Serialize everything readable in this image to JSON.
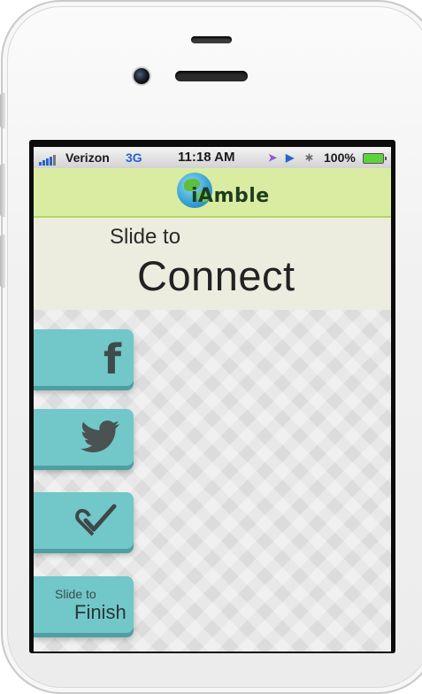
{
  "status_bar": {
    "carrier": "Verizon",
    "network": "3G",
    "time": "11:18 AM",
    "battery_percent": "100%"
  },
  "app": {
    "name": "iAmble"
  },
  "banner": {
    "line1": "Slide to",
    "line2": "Connect"
  },
  "tabs": [
    {
      "id": "facebook",
      "icon": "facebook-icon"
    },
    {
      "id": "twitter",
      "icon": "twitter-icon"
    },
    {
      "id": "foursquare",
      "icon": "checkin-icon"
    },
    {
      "id": "finish",
      "line1": "Slide to",
      "line2": "Finish"
    }
  ],
  "colors": {
    "header_bg": "#daeca2",
    "tab_bg": "#72c7c9",
    "banner_bg": "#ecedde"
  }
}
